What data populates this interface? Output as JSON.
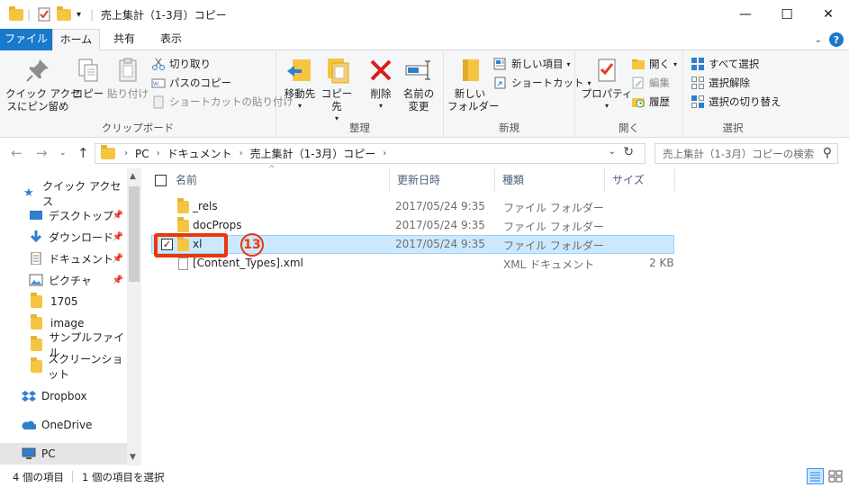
{
  "window": {
    "title": "売上集計（1-3月）コピー",
    "minimize": "—",
    "maximize": "☐",
    "close": "✕"
  },
  "ribbon_tabs": {
    "file": "ファイル",
    "home": "ホーム",
    "share": "共有",
    "view": "表示"
  },
  "ribbon": {
    "clipboard": {
      "label": "クリップボード",
      "pin": "クイック アクセ\nスにピン留め",
      "copy": "コピー",
      "paste": "貼り付け",
      "cut": "切り取り",
      "copy_path": "パスのコピー",
      "paste_shortcut": "ショートカットの貼り付け"
    },
    "organize": {
      "label": "整理",
      "move": "移動先",
      "copyto": "コピー先",
      "delete": "削除",
      "rename": "名前の\n変更"
    },
    "new": {
      "label": "新規",
      "new_folder": "新しい\nフォルダー",
      "new_item": "新しい項目",
      "shortcut": "ショートカット"
    },
    "open": {
      "label": "開く",
      "properties": "プロパティ",
      "open": "開く",
      "edit": "編集",
      "history": "履歴"
    },
    "select": {
      "label": "選択",
      "select_all": "すべて選択",
      "select_none": "選択解除",
      "invert": "選択の切り替え"
    }
  },
  "address": {
    "path": [
      "PC",
      "ドキュメント",
      "売上集計（1-3月）コピー"
    ],
    "search_placeholder": "売上集計（1-3月）コピーの検索"
  },
  "nav": {
    "items": [
      {
        "label": "クイック アクセス"
      },
      {
        "label": "デスクトップ"
      },
      {
        "label": "ダウンロード"
      },
      {
        "label": "ドキュメント"
      },
      {
        "label": "ピクチャ"
      },
      {
        "label": "1705"
      },
      {
        "label": "image"
      },
      {
        "label": "サンプルファイル"
      },
      {
        "label": "スクリーンショット"
      },
      {
        "label": "Dropbox"
      },
      {
        "label": "OneDrive"
      },
      {
        "label": "PC"
      }
    ]
  },
  "columns": {
    "name": "名前",
    "date": "更新日時",
    "type": "種類",
    "size": "サイズ"
  },
  "files": [
    {
      "name": "_rels",
      "date": "2017/05/24 9:35",
      "type": "ファイル フォルダー",
      "size": ""
    },
    {
      "name": "docProps",
      "date": "2017/05/24 9:35",
      "type": "ファイル フォルダー",
      "size": ""
    },
    {
      "name": "xl",
      "date": "2017/05/24 9:35",
      "type": "ファイル フォルダー",
      "size": ""
    },
    {
      "name": "[Content_Types].xml",
      "date": "",
      "type": "XML ドキュメント",
      "size": "2 KB"
    }
  ],
  "callout": {
    "number": "13"
  },
  "status": {
    "count": "4 個の項目",
    "selected": "1 個の項目を選択"
  },
  "colors": {
    "accent": "#1979ca",
    "selection": "#cce8ff",
    "callout": "#e8380d",
    "folder": "#f5c542"
  }
}
